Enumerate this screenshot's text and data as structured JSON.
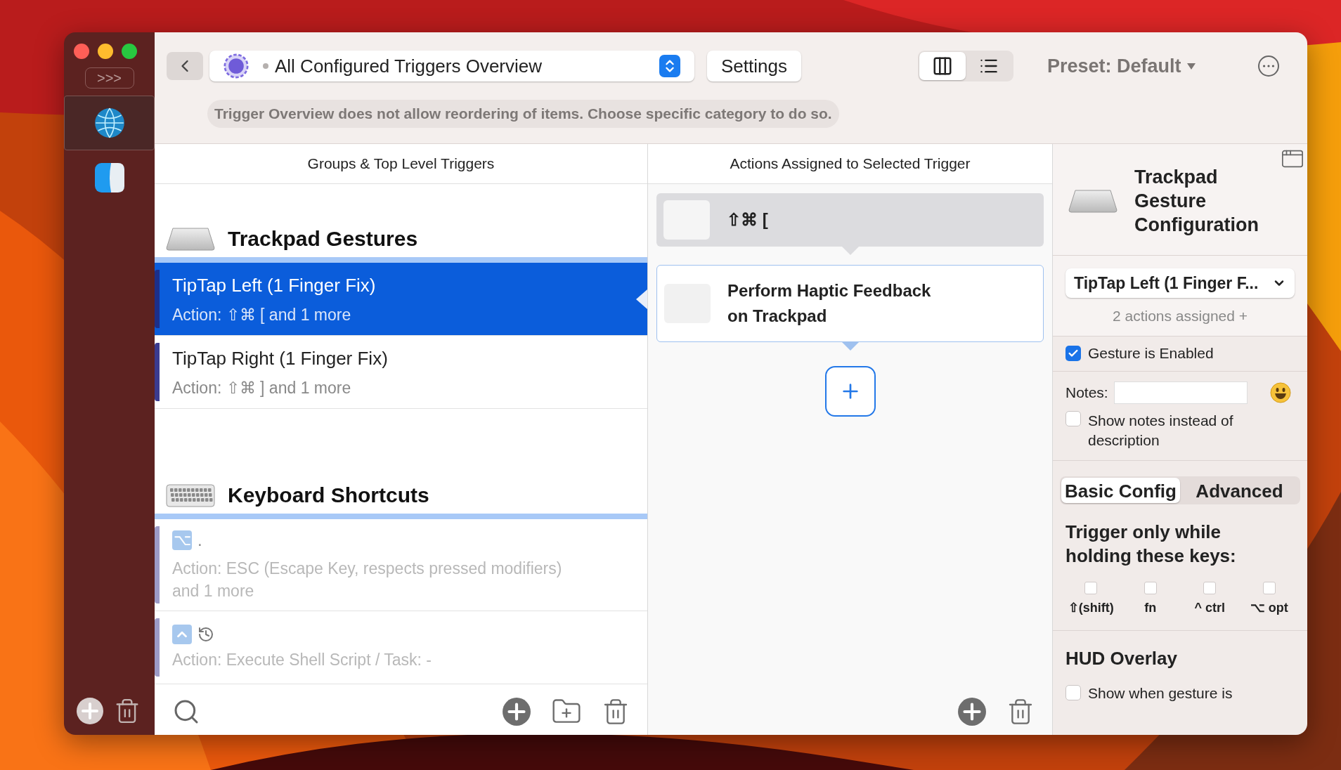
{
  "sidebar": {
    "expand_label": ">>>",
    "apps": [
      {
        "kind": "globe",
        "selected": true
      },
      {
        "kind": "finder",
        "selected": false
      }
    ]
  },
  "toolbar": {
    "trigger_selector": {
      "label": "All Configured Triggers Overview"
    },
    "settings_button": "Settings",
    "view_modes": [
      {
        "kind": "columns",
        "selected": true
      },
      {
        "kind": "list",
        "selected": false
      }
    ],
    "preset": "Preset: Default",
    "notice": "Trigger Overview does not allow reordering of items. Choose specific category to do so."
  },
  "triggers_column": {
    "heading": "Groups & Top Level Triggers",
    "groups": [
      {
        "kind": "trackpad",
        "title": "Trackpad Gestures",
        "items": [
          {
            "title": "TipTap Left (1 Finger Fix)",
            "action": "Action: ⇧⌘ [ and 1 more",
            "selected": true,
            "enabled": true
          },
          {
            "title": "TipTap Right (1 Finger Fix)",
            "action": "Action: ⇧⌘ ] and 1 more",
            "selected": false,
            "enabled": true
          }
        ]
      },
      {
        "kind": "keyboard",
        "title": "Keyboard Shortcuts",
        "items": [
          {
            "badges": [
              {
                "kind": "text",
                "text": "⌥"
              }
            ],
            "title": ".",
            "action": "Action: ESC (Escape Key, respects pressed modifiers) and 1 more",
            "selected": false,
            "enabled": false
          },
          {
            "badges": [
              {
                "kind": "control"
              },
              {
                "kind": "history"
              }
            ],
            "action": "Action: Execute Shell Script / Task: -",
            "selected": false,
            "enabled": false
          }
        ]
      }
    ]
  },
  "actions_column": {
    "heading": "Actions Assigned to Selected Trigger",
    "actions": [
      {
        "title": "⇧⌘ [",
        "selected": true
      },
      {
        "title": "Perform Haptic Feedback on Trackpad",
        "selected": false
      }
    ]
  },
  "config_panel": {
    "title": "Trackpad Gesture Configuration",
    "trigger_dropdown": "TipTap Left (1 Finger F...",
    "actions_assigned": "2 actions assigned +",
    "enabled_checkbox": {
      "label": "Gesture is Enabled",
      "checked": true
    },
    "notes_label": "Notes:",
    "show_notes_checkbox": {
      "label": "Show notes instead of description",
      "checked": false
    },
    "tabs": [
      {
        "label": "Basic Config",
        "selected": true
      },
      {
        "label": "Advanced",
        "selected": false
      }
    ],
    "modifier_heading": "Trigger only while holding these keys:",
    "modifiers": [
      {
        "label": "⇧(shift)",
        "checked": false
      },
      {
        "label": "fn",
        "checked": false
      },
      {
        "label": "^ ctrl",
        "checked": false
      },
      {
        "label": "⌥ opt",
        "checked": false
      }
    ],
    "hud_heading": "HUD Overlay",
    "hud_checkbox": {
      "label": "Show when gesture is",
      "checked": false
    }
  }
}
